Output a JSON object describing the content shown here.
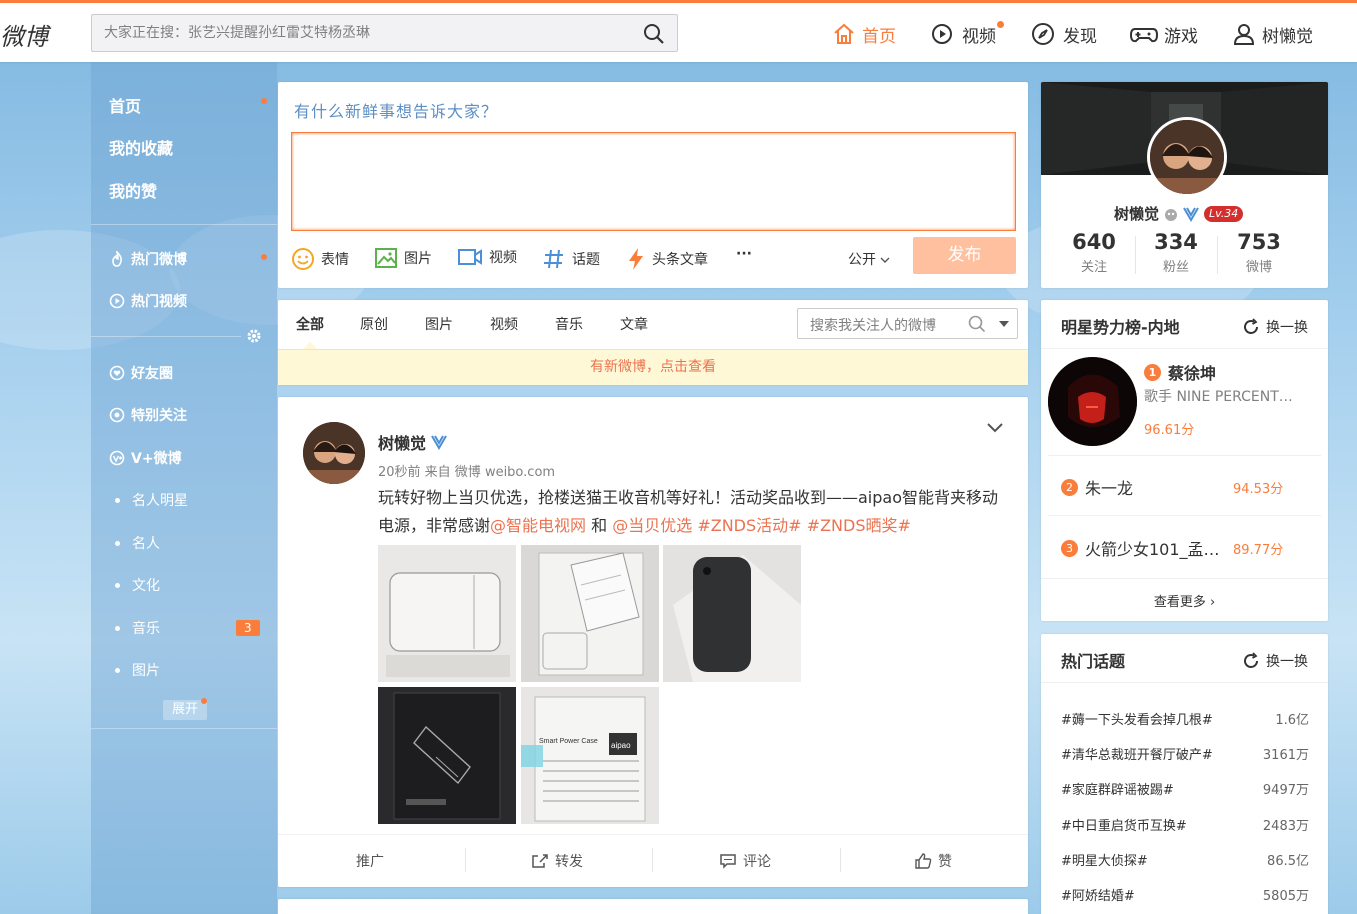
{
  "topbar": {
    "logo": "微博",
    "search_placeholder": "大家正在搜：张艺兴提醒孙红雷艾特杨丞琳",
    "nav": [
      {
        "label": "首页",
        "icon": "home-icon",
        "active": true
      },
      {
        "label": "视频",
        "icon": "video-icon",
        "dot": true
      },
      {
        "label": "发现",
        "icon": "compass-icon"
      },
      {
        "label": "游戏",
        "icon": "gamepad-icon"
      },
      {
        "label": "树懒觉",
        "icon": "user-icon"
      }
    ],
    "accent": "#fa7d3c"
  },
  "leftnav": {
    "main": [
      "首页",
      "我的收藏",
      "我的赞"
    ],
    "hot": [
      "热门微博",
      "热门视频"
    ],
    "groups": [
      "好友圈",
      "特别关注",
      "V+微博"
    ],
    "categories": [
      "名人明星",
      "名人",
      "文化",
      "音乐",
      "图片"
    ],
    "music_badge": "3",
    "expand": "展开"
  },
  "composer": {
    "prompt": "有什么新鲜事想告诉大家？",
    "tools": [
      "表情",
      "图片",
      "视频",
      "话题",
      "头条文章",
      "···"
    ],
    "visibility": "公开",
    "publish": "发布"
  },
  "feed_tabs": {
    "tabs": [
      "全部",
      "原创",
      "图片",
      "视频",
      "音乐",
      "文章"
    ],
    "search_placeholder": "搜索我关注人的微博",
    "notice": "有新微博，点击查看"
  },
  "post": {
    "author": "树懒觉",
    "meta": "20秒前 来自 微博 weibo.com",
    "text_1": "玩转好物上当贝优选，抢楼送猫王收音机等好礼！活动奖品收到——aipao智能背夹移动电源，非常感谢",
    "mention_1": "@智能电视网",
    "and": " 和 ",
    "mention_2": "@当贝优选",
    "tag_1": "#ZNDS活动#",
    "tag_2": "#ZNDS晒奖#",
    "images": [
      {
        "desc": "white phone case diagram box"
      },
      {
        "desc": "opened box with instructions"
      },
      {
        "desc": "black phone case"
      },
      {
        "desc": "black box with diagram"
      },
      {
        "desc": "box label",
        "caption": "Smart Power Case",
        "brand": "aipao"
      }
    ],
    "actions": [
      "推广",
      "转发",
      "评论",
      "赞"
    ]
  },
  "profile": {
    "name": "树懒觉",
    "level": "Lv.34",
    "stats": [
      {
        "n": "640",
        "l": "关注"
      },
      {
        "n": "334",
        "l": "粉丝"
      },
      {
        "n": "753",
        "l": "微博"
      }
    ]
  },
  "star_rank": {
    "title": "明星势力榜-内地",
    "refresh": "换一换",
    "top": {
      "rank": "1",
      "name": "蔡徐坤",
      "desc": "歌手 NINE PERCENT…",
      "score": "96.61分"
    },
    "list": [
      {
        "rank": "2",
        "name": "朱一龙",
        "score": "94.53分"
      },
      {
        "rank": "3",
        "name": "火箭少女101_孟…",
        "score": "89.77分"
      }
    ],
    "more": "查看更多 ›"
  },
  "hot_topics": {
    "title": "热门话题",
    "refresh": "换一换",
    "items": [
      {
        "t": "#薅一下头发看会掉几根#",
        "c": "1.6亿"
      },
      {
        "t": "#清华总裁班开餐厅破产#",
        "c": "3161万"
      },
      {
        "t": "#家庭群辟谣被踢#",
        "c": "9497万"
      },
      {
        "t": "#中日重启货币互换#",
        "c": "2483万"
      },
      {
        "t": "#明星大侦探#",
        "c": "86.5亿"
      },
      {
        "t": "#阿娇结婚#",
        "c": "5805万"
      }
    ]
  }
}
